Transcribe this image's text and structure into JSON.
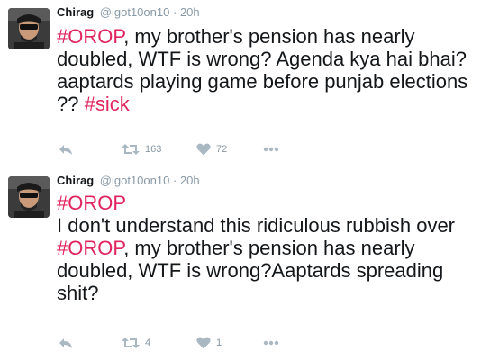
{
  "tweets": [
    {
      "author_name": "Chirag",
      "handle": "@igot10on10",
      "separator": "·",
      "time": "20h",
      "hashtag_1": "#OROP",
      "text_1": ", my brother's pension has nearly doubled, WTF is wrong? Agenda kya hai bhai? aaptards playing game before punjab elections ?? ",
      "hashtag_2": "#sick",
      "retweets": "163",
      "likes": "72"
    },
    {
      "author_name": "Chirag",
      "handle": "@igot10on10",
      "separator": "·",
      "time": "20h",
      "hashtag_1": "#OROP",
      "line_2": "I don't understand this ridiculous rubbish over ",
      "hashtag_2": "#OROP",
      "text_2": ", my brother's pension has nearly doubled, WTF is wrong?Aaptards spreading shit?",
      "retweets": "4",
      "likes": "1"
    }
  ],
  "icons": {
    "reply": "reply-icon",
    "retweet": "retweet-icon",
    "like": "heart-icon",
    "more": "more-icon"
  },
  "colors": {
    "hashtag": "#e0245e",
    "text": "#14171a",
    "muted": "#8899a6",
    "icon": "#aab8c2",
    "divider": "#e1e8ed"
  }
}
